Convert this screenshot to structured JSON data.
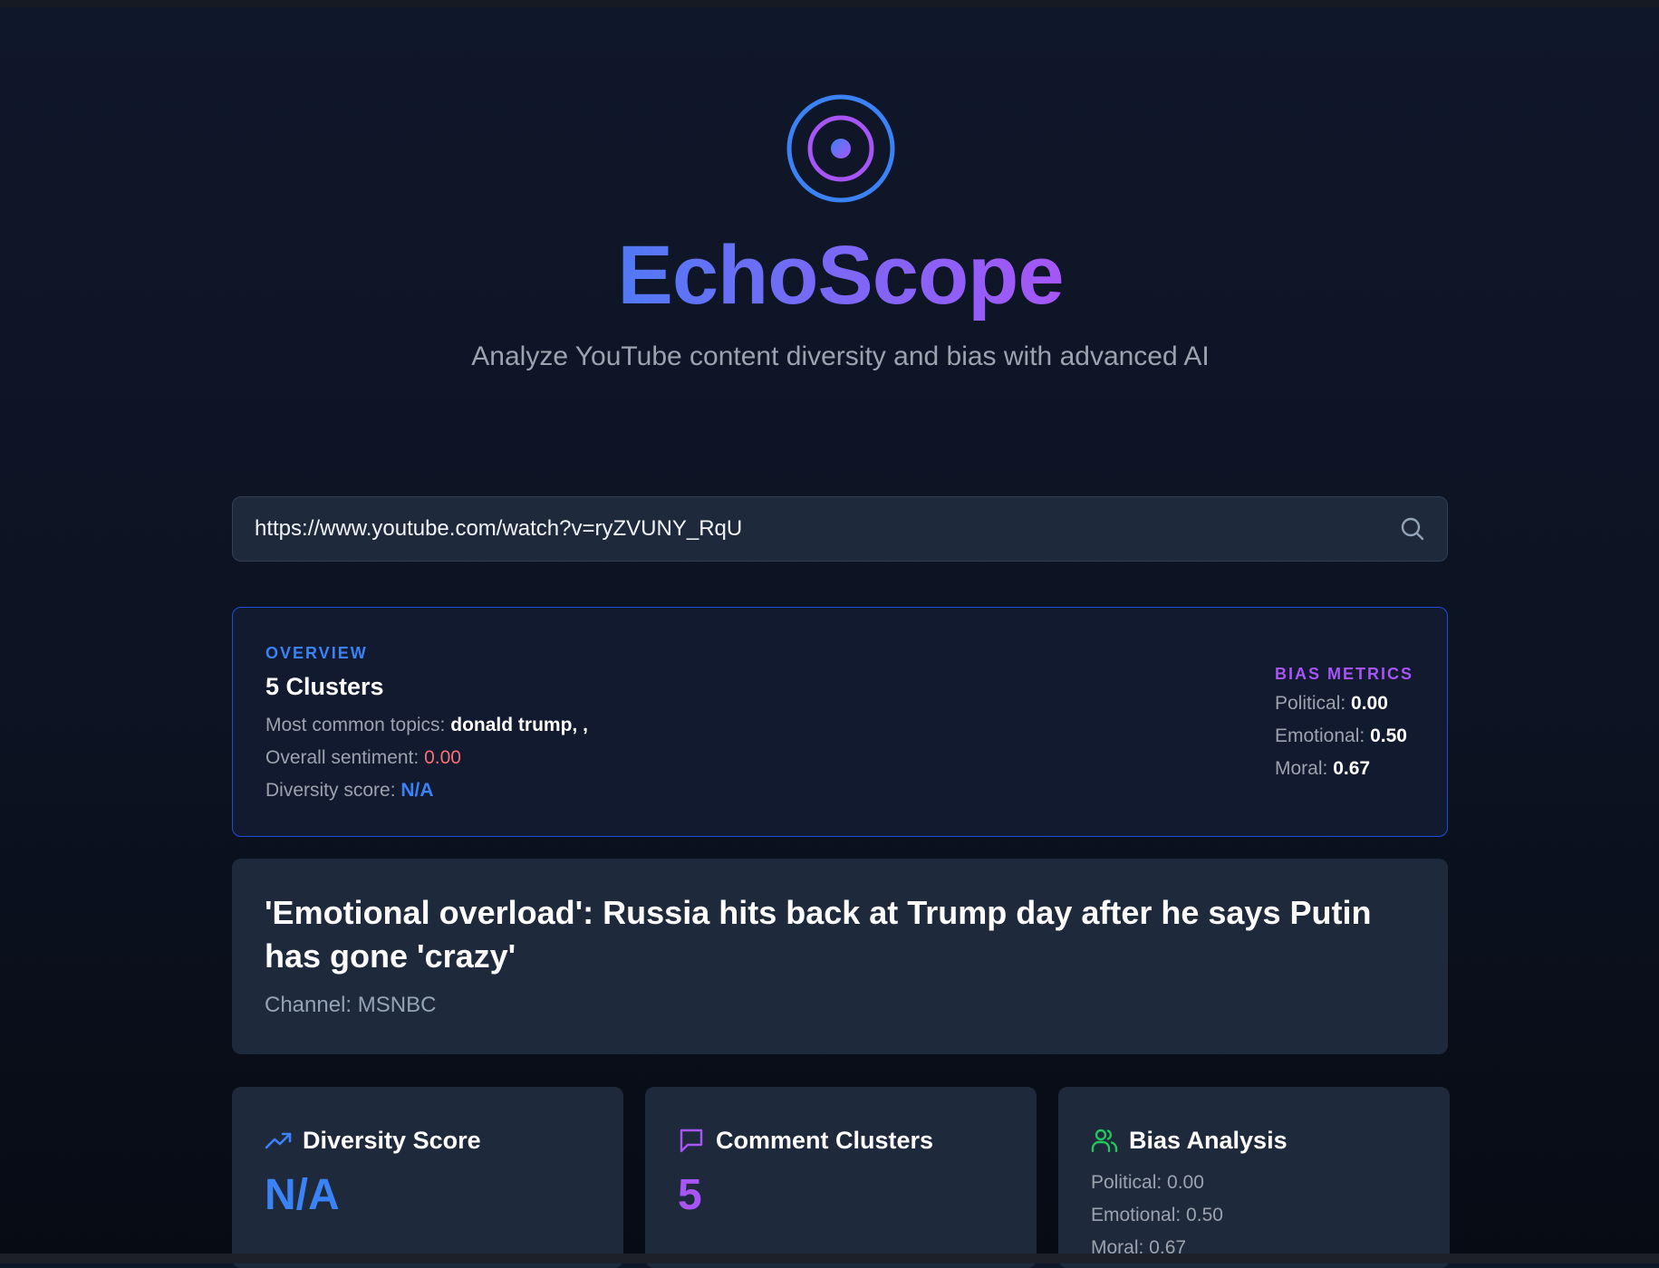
{
  "app": {
    "title": "EchoScope",
    "subtitle": "Analyze YouTube content diversity and bias with advanced AI"
  },
  "search": {
    "value": "https://www.youtube.com/watch?v=ryZVUNY_RqU",
    "icon": "search-icon"
  },
  "overview": {
    "label": "OVERVIEW",
    "title": "5 Clusters",
    "topics_label": "Most common topics:",
    "topics_value": "donald trump, ,",
    "sentiment_label": "Overall sentiment:",
    "sentiment_value": "0.00",
    "diversity_label": "Diversity score:",
    "diversity_value": "N/A",
    "bias": {
      "label": "BIAS METRICS",
      "political_label": "Political:",
      "political_value": "0.00",
      "emotional_label": "Emotional:",
      "emotional_value": "0.50",
      "moral_label": "Moral:",
      "moral_value": "0.67"
    }
  },
  "video": {
    "title": "'Emotional overload': Russia hits back at Trump day after he says Putin has gone 'crazy'",
    "channel": "Channel: MSNBC"
  },
  "cards": {
    "diversity": {
      "title": "Diversity Score",
      "value": "N/A",
      "icon": "trending-up-icon"
    },
    "clusters": {
      "title": "Comment Clusters",
      "value": "5",
      "icon": "message-square-icon"
    },
    "bias": {
      "title": "Bias Analysis",
      "icon": "users-icon",
      "political": "Political: 0.00",
      "emotional": "Emotional: 0.50",
      "moral": "Moral: 0.67"
    }
  },
  "colors": {
    "accent_blue": "#3b82f6",
    "accent_purple": "#a855f7",
    "accent_green": "#22c55e",
    "negative_red": "#f87171",
    "card_bg": "#1e293b"
  }
}
